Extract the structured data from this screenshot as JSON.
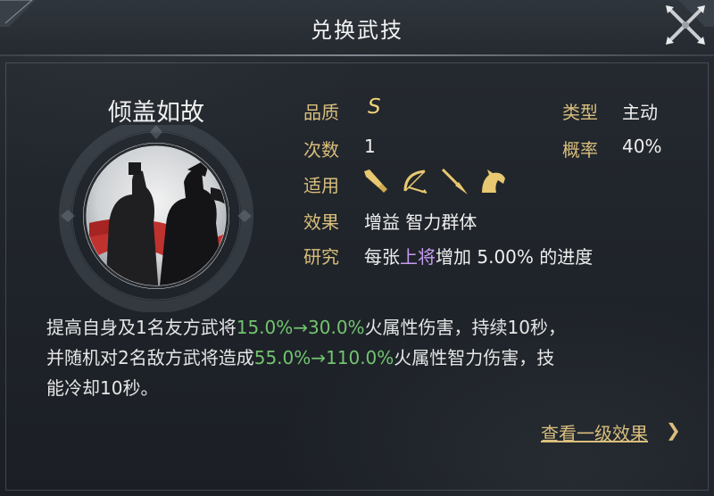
{
  "dialog": {
    "title": "兑换武技",
    "close_icon": "crossed-swords-close-icon"
  },
  "skill": {
    "name": "倾盖如故",
    "portrait": "two-warriors-silhouette-with-red-scarf"
  },
  "attributes": {
    "quality_label": "品质",
    "quality_value": "S",
    "count_label": "次数",
    "count_value": "1",
    "apply_label": "适用",
    "apply_icons": [
      "sword-icon",
      "bow-icon",
      "spear-icon",
      "horse-icon"
    ],
    "effect_label": "效果",
    "effect_value": "增益 智力群体",
    "research_label": "研究",
    "research_prefix": "每张",
    "research_highlight": "上将",
    "research_suffix": "增加 5.00% 的进度",
    "type_label": "类型",
    "type_value": "主动",
    "rate_label": "概率",
    "rate_value": "40%"
  },
  "description": {
    "p1": "提高自身及1名友方武将",
    "g1": "15.0%→30.0%",
    "p2": "火属性伤害，持续10秒，",
    "p3": "并随机对2名敌方武将造成",
    "g2": "55.0%→110.0%",
    "p4": "火属性智力伤害，技",
    "p5": "能冷却10秒。"
  },
  "footer": {
    "link_label": "查看一级效果",
    "arrow": "❯"
  },
  "colors": {
    "label_gold": "#d9be7c",
    "highlight_purple": "#c79cf2",
    "value_green": "#72c46f",
    "portrait_red": "#c0322e"
  }
}
